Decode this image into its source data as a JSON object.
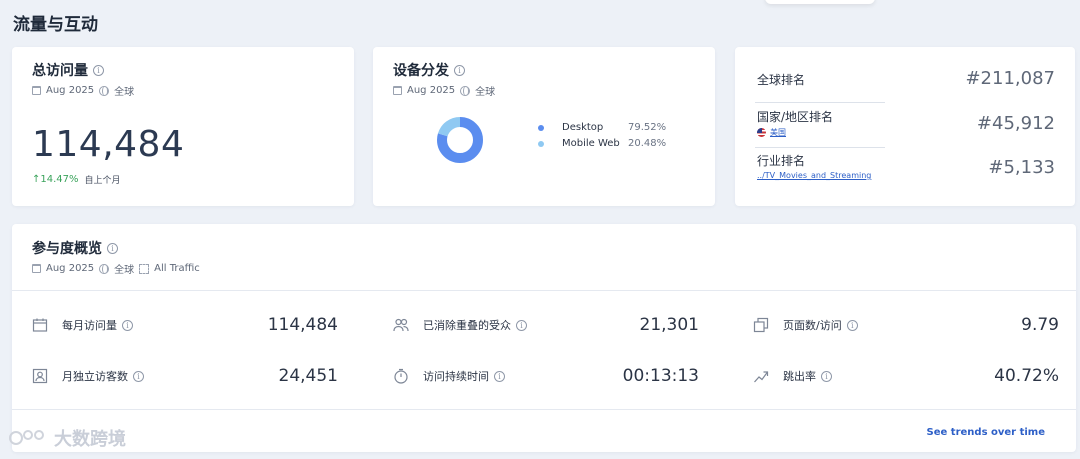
{
  "section_title": "流量与互动",
  "visits_card": {
    "title": "总访问量",
    "period": "Aug 2025",
    "region": "全球",
    "value": "114,484",
    "change": "↑14.47%",
    "change_caption": "自上个月",
    "change_color": "#3aa35b"
  },
  "device_card": {
    "title": "设备分发",
    "period": "Aug 2025",
    "region": "全球",
    "items": [
      {
        "name": "Desktop",
        "pct_text": "79.52%",
        "pct": 79.52,
        "color": "#5b8def"
      },
      {
        "name": "Mobile Web",
        "pct_text": "20.48%",
        "pct": 20.48,
        "color": "#8fc9f2"
      }
    ]
  },
  "rank_card": {
    "global_label": "全球排名",
    "global_value": "#211,087",
    "country_label": "国家/地区排名",
    "country_sub": "美国",
    "country_value": "#45,912",
    "industry_label": "行业排名",
    "industry_sub": "../TV_Movies_and_Streaming",
    "industry_value": "#5,133"
  },
  "engagement": {
    "title": "参与度概览",
    "period": "Aug 2025",
    "region": "全球",
    "traffic": "All Traffic",
    "metrics": [
      {
        "label": "每月访问量",
        "value": "114,484",
        "icon": "calendar-icon"
      },
      {
        "label": "已消除重叠的受众",
        "value": "21,301",
        "icon": "users-icon"
      },
      {
        "label": "页面数/访问",
        "value": "9.79",
        "icon": "pages-icon"
      },
      {
        "label": "月独立访客数",
        "value": "24,451",
        "icon": "visitor-id-icon"
      },
      {
        "label": "访问持续时间",
        "value": "00:13:13",
        "icon": "stopwatch-icon"
      },
      {
        "label": "跳出率",
        "value": "40.72%",
        "icon": "trend-icon"
      }
    ],
    "see_trends": "See trends over time"
  },
  "watermark": "大数跨境"
}
